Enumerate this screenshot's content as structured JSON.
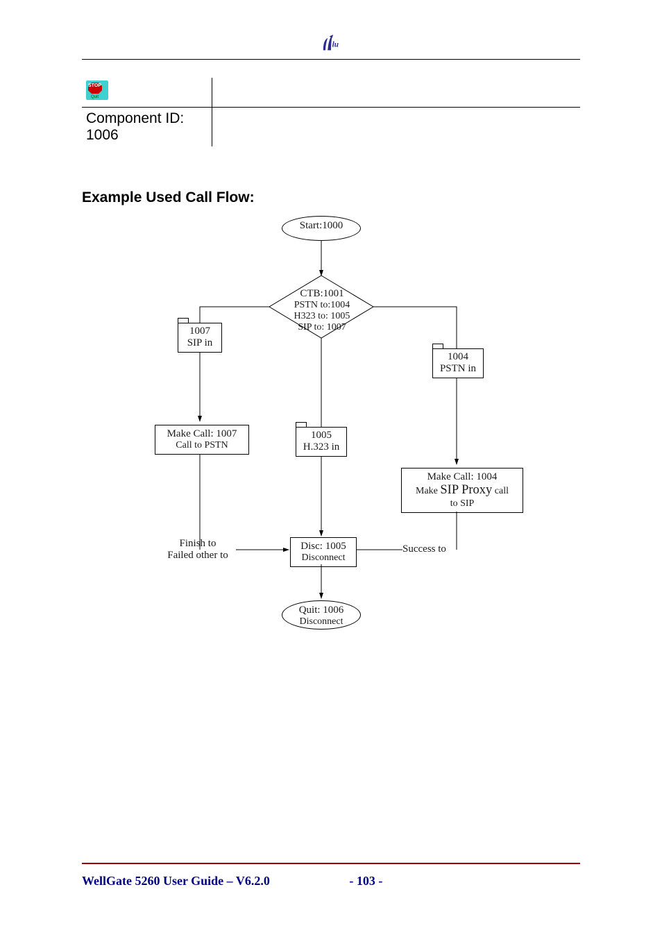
{
  "top_table": {
    "component_id_label": "Component ID: 1006"
  },
  "section_heading": "Example Used Call Flow:",
  "flow": {
    "start": {
      "label": "Start:1000"
    },
    "ctb": {
      "title": "CTB:1001",
      "line1": "PSTN to:1004",
      "line2": "H323 to: 1005",
      "line3": "SIP to: 1007"
    },
    "sip_in": {
      "id": "1007",
      "label": "SIP in"
    },
    "pstn_in": {
      "id": "1004",
      "label": "PSTN in"
    },
    "make_call_1007": {
      "title": "Make Call: 1007",
      "sub": "Call to PSTN"
    },
    "h323_in": {
      "id": "1005",
      "label": "H.323 in"
    },
    "make_call_1004": {
      "title": "Make Call: 1004",
      "sub_prefix": "Make ",
      "sub_mid": "SIP Proxy",
      "sub_suffix": " call",
      "sub2": "to SIP"
    },
    "finish": {
      "line1": "Finish to",
      "line2": "Failed other to"
    },
    "disc": {
      "title": "Disc: 1005",
      "sub": "Disconnect"
    },
    "success": "Success to",
    "quit": {
      "title": "Quit: 1006",
      "sub": "Disconnect"
    }
  },
  "footer": {
    "doc_title": "WellGate 5260 User Guide – V6.2.0",
    "page_number": "- 103 -"
  }
}
